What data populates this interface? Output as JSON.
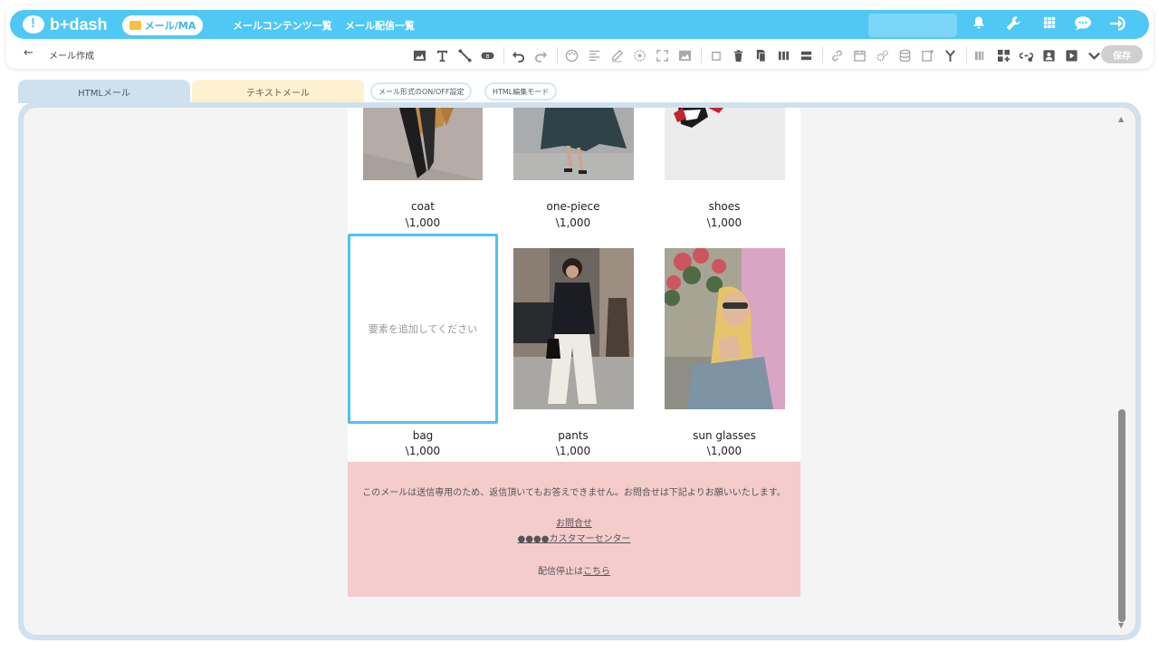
{
  "header": {
    "logo_text": "b+dash",
    "mode_label": "メール/MA",
    "nav_links": [
      "メールコンテンツ一覧",
      "メール配信一覧"
    ],
    "page_title": "メール作成",
    "save_label": "保存"
  },
  "tabs": {
    "html": "HTMLメール",
    "text": "テキストメール",
    "format_toggle": "メール形式のON/OFF設定",
    "html_edit_mode": "HTML編集モード"
  },
  "colors": {
    "brand": "#4fc8f5",
    "selection": "#4ec3ee",
    "footer_bg": "#f4cccc"
  },
  "products_top": [
    {
      "name": "coat",
      "price": "\\1,000"
    },
    {
      "name": "one-piece",
      "price": "\\1,000"
    },
    {
      "name": "shoes",
      "price": "\\1,000"
    }
  ],
  "products_bottom": [
    {
      "name": "bag",
      "price": "\\1,000"
    },
    {
      "name": "pants",
      "price": "\\1,000"
    },
    {
      "name": "sun glasses",
      "price": "\\1,000"
    }
  ],
  "drop_zone_text": "要素を追加してください",
  "footer": {
    "notice": "このメールは送信専用のため、返信頂いてもお答えできません。お問合せは下記よりお願いいたします。",
    "contact_link": "お問合せ",
    "center_link": "●●●●カスタマーセンター",
    "unsubscribe_prefix": "配信停止は",
    "unsubscribe_link": "こちら"
  }
}
